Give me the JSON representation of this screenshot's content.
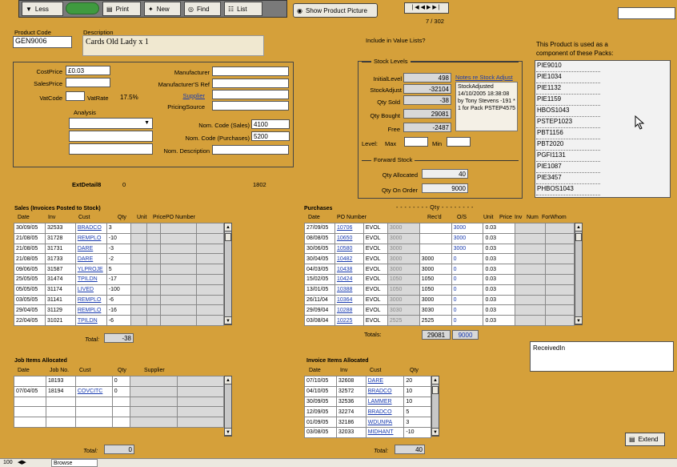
{
  "toolbar": {
    "less": "Less",
    "print": "Print",
    "new": "New",
    "find": "Find",
    "list": "List",
    "show_picture": "Show Product Picture",
    "record_pos": "7 / 302"
  },
  "product": {
    "code_label": "Product Code",
    "code": "GEN9006",
    "desc_label": "Description",
    "desc": "Cards Old Lady x 1",
    "include_label": "Include in Value Lists?"
  },
  "pricing": {
    "cost_label": "CostPrice",
    "cost": "£0.03",
    "sales_label": "SalesPrice",
    "vat_code_label": "VatCode",
    "vat_rate_label": "VatRate",
    "vat_rate": "17.5%",
    "analysis_label": "Analysis",
    "manufacturer_label": "Manufacturer",
    "manuf_ref_label": "Manufacturer'S Ref",
    "supplier_label": "Supplier",
    "pricing_source_label": "PricingSource",
    "nom_sales_label": "Nom. Code (Sales)",
    "nom_sales": "4100",
    "nom_purch_label": "Nom. Code (Purchases)",
    "nom_purch": "5200",
    "nom_desc_label": "Nom. Description",
    "ext_label": "ExtDetail8",
    "ext_value": "0",
    "ext_number": "1802"
  },
  "stock": {
    "title": "Stock Levels",
    "initial_label": "InitialLevel",
    "initial": "498",
    "adjust_label": "StockAdjust",
    "adjust": "-32104",
    "sold_label": "Qty Sold",
    "sold": "-38",
    "bought_label": "Qty Bought",
    "bought": "29081",
    "free_label": "Free",
    "free": "-2487",
    "level_label": "Level:",
    "max_label": "Max",
    "min_label": "Min",
    "notes_label": "Notes re Stock Adjust",
    "notes": "StockAdjusted 14/10/2005 18:38:08 by Tony Stevens -191 * 1 for Pack PSTEP4575"
  },
  "forward": {
    "title": "Forward Stock",
    "allocated_label": "Qty Allocated",
    "allocated": "40",
    "on_order_label": "Qty On Order",
    "on_order": "9000"
  },
  "packs": {
    "title": "This Product is used as a component of these Packs:",
    "items": [
      "PIE9010",
      "PIE1034",
      "PIE1132",
      "PIE1159",
      "HBOS1043",
      "PSTEP1023",
      "PBT1156",
      "PBT2020",
      "PGFI1131",
      "PIE1087",
      "PIE3457",
      "PHBOS1043"
    ]
  },
  "sales": {
    "title": "Sales (Invoices Posted to Stock)",
    "headers": [
      "Date",
      "Inv",
      "Cust",
      "Qty",
      "Unit",
      "Price",
      "PO Number"
    ],
    "rows": [
      [
        "30/09/05",
        "32533",
        "BRADCO",
        "3"
      ],
      [
        "21/08/05",
        "31728",
        "REMPLO",
        "-10"
      ],
      [
        "21/08/05",
        "31731",
        "DARE",
        "-3"
      ],
      [
        "21/08/05",
        "31733",
        "DARE",
        "-2"
      ],
      [
        "09/06/05",
        "31587",
        "YLPROJE",
        "5"
      ],
      [
        "25/05/05",
        "31474",
        "TPILDN",
        "-17"
      ],
      [
        "05/05/05",
        "31174",
        "LIVED",
        "-100"
      ],
      [
        "03/05/05",
        "31141",
        "REMPLO",
        "-6"
      ],
      [
        "29/04/05",
        "31129",
        "REMPLO",
        "-16"
      ],
      [
        "22/04/05",
        "31021",
        "TPILDN",
        "-6"
      ]
    ],
    "total_label": "Total:",
    "total": "-38"
  },
  "purchases": {
    "title": "Purchases",
    "qty_header": "- - - - - - - -  Qty  - - - - - - - -",
    "headers": [
      "Date",
      "PO Number",
      "Rec'd",
      "O/S",
      "Unit",
      "Price",
      "Inv",
      "Num",
      "ForWhom"
    ],
    "rows": [
      [
        "27/09/05",
        "10706",
        "EVOL",
        "3000",
        "",
        "3000",
        "0.03"
      ],
      [
        "08/08/05",
        "10650",
        "EVOL",
        "3000",
        "",
        "3000",
        "0.03"
      ],
      [
        "30/06/05",
        "10580",
        "EVOL",
        "3000",
        "",
        "3000",
        "0.03"
      ],
      [
        "30/04/05",
        "10482",
        "EVOL",
        "3000",
        "3000",
        "0",
        "0.03"
      ],
      [
        "04/03/05",
        "10438",
        "EVOL",
        "3000",
        "3000",
        "0",
        "0.03"
      ],
      [
        "15/02/05",
        "10424",
        "EVOL",
        "1050",
        "1050",
        "0",
        "0.03"
      ],
      [
        "13/01/05",
        "10388",
        "EVOL",
        "1050",
        "1050",
        "0",
        "0.03"
      ],
      [
        "26/11/04",
        "10364",
        "EVOL",
        "3000",
        "3000",
        "0",
        "0.03"
      ],
      [
        "29/09/04",
        "10288",
        "EVOL",
        "3030",
        "3030",
        "0",
        "0.03"
      ],
      [
        "03/08/04",
        "10225",
        "EVOL",
        "2525",
        "2525",
        "0",
        "0.03"
      ]
    ],
    "total_label": "Totals:",
    "total_recd": "29081",
    "total_os": "9000"
  },
  "received": {
    "label": "ReceivedIn"
  },
  "jobs": {
    "title": "Job Items Allocated",
    "headers": [
      "Date",
      "Job No.",
      "Cust",
      "Qty",
      "Supplier"
    ],
    "rows": [
      [
        "",
        "18193",
        "",
        "0"
      ],
      [
        "07/04/05",
        "18194",
        "COVCITC",
        "0"
      ]
    ],
    "total_label": "Total:",
    "total": "0"
  },
  "invoices": {
    "title": "Invoice Items Allocated",
    "headers": [
      "Date",
      "Inv",
      "Cust",
      "Qty"
    ],
    "rows": [
      [
        "07/10/05",
        "32608",
        "DARE",
        "20"
      ],
      [
        "04/10/05",
        "32572",
        "BRADCO",
        "10"
      ],
      [
        "30/09/05",
        "32536",
        "LAMMER",
        "10"
      ],
      [
        "12/09/05",
        "32274",
        "BRADCO",
        "5"
      ],
      [
        "01/09/05",
        "32186",
        "WDUNPA",
        "3"
      ],
      [
        "03/08/05",
        "32033",
        "MIDHANT",
        "-10"
      ]
    ],
    "total_label": "Total:",
    "total": "40"
  },
  "extend_label": "Extend",
  "status": {
    "record": "100",
    "mode": "Browse"
  }
}
